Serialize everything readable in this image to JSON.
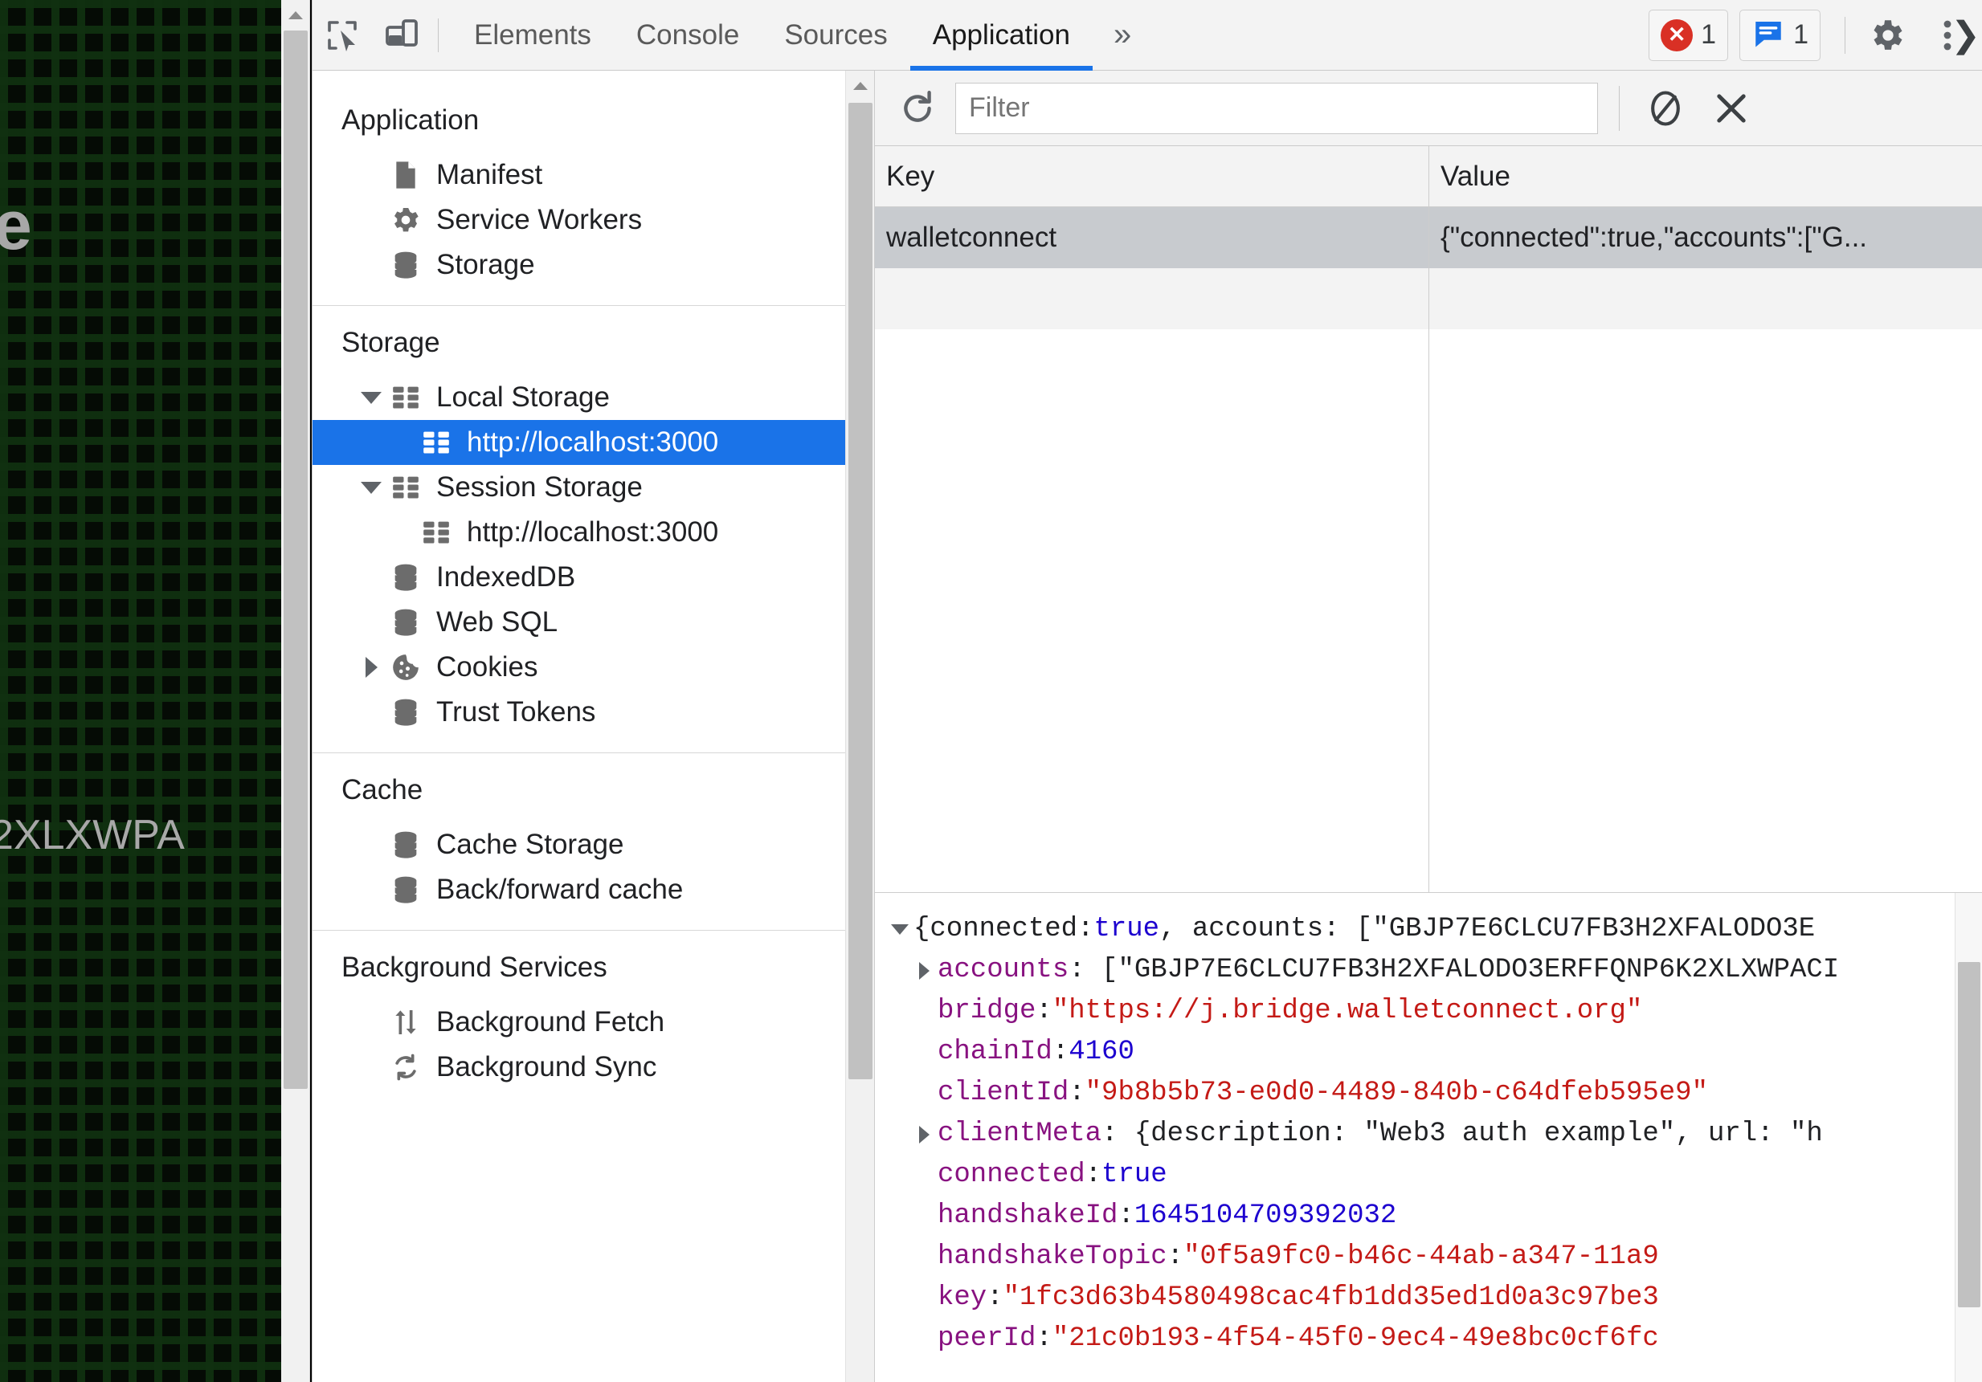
{
  "page_behind": {
    "partial_letter": "e",
    "partial_address": "2XLXWPA"
  },
  "devtools": {
    "toolbar": {
      "inspect_icon": "inspect-cursor-icon",
      "device_toggle_icon": "device-toolbar-icon",
      "tabs": [
        {
          "label": "Elements",
          "active": false
        },
        {
          "label": "Console",
          "active": false
        },
        {
          "label": "Sources",
          "active": false
        },
        {
          "label": "Application",
          "active": true
        }
      ],
      "more_tabs_label": "»",
      "error_badge": {
        "icon": "error-circle-icon",
        "count": "1"
      },
      "message_badge": {
        "icon": "message-bubble-icon",
        "count": "1"
      },
      "settings_icon": "gear-icon",
      "menu_icon": "kebab-menu-icon",
      "close_icon": "chevron-right-icon"
    },
    "sidebar": {
      "sections": [
        {
          "title": "Application",
          "items": [
            {
              "label": "Manifest",
              "icon": "manifest-file-icon",
              "indent": 1,
              "twisty": "none",
              "selected": false
            },
            {
              "label": "Service Workers",
              "icon": "gear-icon",
              "indent": 1,
              "twisty": "none",
              "selected": false
            },
            {
              "label": "Storage",
              "icon": "database-icon",
              "indent": 1,
              "twisty": "none",
              "selected": false
            }
          ]
        },
        {
          "title": "Storage",
          "items": [
            {
              "label": "Local Storage",
              "icon": "table-grid-icon",
              "indent": 1,
              "twisty": "open",
              "selected": false
            },
            {
              "label": "http://localhost:3000",
              "icon": "table-grid-icon",
              "indent": 2,
              "twisty": "none",
              "selected": true
            },
            {
              "label": "Session Storage",
              "icon": "table-grid-icon",
              "indent": 1,
              "twisty": "open",
              "selected": false
            },
            {
              "label": "http://localhost:3000",
              "icon": "table-grid-icon",
              "indent": 2,
              "twisty": "none",
              "selected": false
            },
            {
              "label": "IndexedDB",
              "icon": "database-icon",
              "indent": 1,
              "twisty": "none",
              "selected": false
            },
            {
              "label": "Web SQL",
              "icon": "database-icon",
              "indent": 1,
              "twisty": "none",
              "selected": false
            },
            {
              "label": "Cookies",
              "icon": "cookie-icon",
              "indent": 1,
              "twisty": "closed",
              "selected": false
            },
            {
              "label": "Trust Tokens",
              "icon": "database-icon",
              "indent": 1,
              "twisty": "none",
              "selected": false
            }
          ]
        },
        {
          "title": "Cache",
          "items": [
            {
              "label": "Cache Storage",
              "icon": "database-icon",
              "indent": 1,
              "twisty": "none",
              "selected": false
            },
            {
              "label": "Back/forward cache",
              "icon": "database-icon",
              "indent": 1,
              "twisty": "none",
              "selected": false
            }
          ]
        },
        {
          "title": "Background Services",
          "items": [
            {
              "label": "Background Fetch",
              "icon": "background-fetch-icon",
              "indent": 1,
              "twisty": "none",
              "selected": false
            },
            {
              "label": "Background Sync",
              "icon": "background-sync-icon",
              "indent": 1,
              "twisty": "none",
              "selected": false
            }
          ]
        }
      ]
    },
    "filter_bar": {
      "refresh_icon": "refresh-icon",
      "filter_placeholder": "Filter",
      "filter_value": "",
      "clear_all_icon": "clear-all-circle-slash-icon",
      "delete_icon": "delete-x-icon"
    },
    "storage_table": {
      "columns": [
        "Key",
        "Value"
      ],
      "rows": [
        {
          "key": "walletconnect",
          "value": "{\"connected\":true,\"accounts\":[\"G...",
          "selected": true
        }
      ]
    },
    "preview": {
      "lines": [
        {
          "twisty": "open",
          "indent": 0,
          "parts": [
            {
              "text": "{connected: ",
              "cls": "k-plain"
            },
            {
              "text": "true",
              "cls": "k-bool"
            },
            {
              "text": ", accounts: [",
              "cls": "k-plain"
            },
            {
              "text": "\"GBJP7E6CLCU7FB3H2XFALODO3E",
              "cls": "k-plain"
            }
          ]
        },
        {
          "twisty": "closed",
          "indent": 1,
          "parts": [
            {
              "text": "accounts",
              "cls": "k-prop"
            },
            {
              "text": ": [",
              "cls": "k-plain"
            },
            {
              "text": "\"GBJP7E6CLCU7FB3H2XFALODO3ERFFQNP6K2XLXWPACI",
              "cls": "k-plain"
            }
          ]
        },
        {
          "twisty": "none",
          "indent": 1,
          "parts": [
            {
              "text": "bridge",
              "cls": "k-prop"
            },
            {
              "text": ": ",
              "cls": "k-plain"
            },
            {
              "text": "\"https://j.bridge.walletconnect.org\"",
              "cls": "k-str"
            }
          ]
        },
        {
          "twisty": "none",
          "indent": 1,
          "parts": [
            {
              "text": "chainId",
              "cls": "k-prop"
            },
            {
              "text": ": ",
              "cls": "k-plain"
            },
            {
              "text": "4160",
              "cls": "k-num"
            }
          ]
        },
        {
          "twisty": "none",
          "indent": 1,
          "parts": [
            {
              "text": "clientId",
              "cls": "k-prop"
            },
            {
              "text": ": ",
              "cls": "k-plain"
            },
            {
              "text": "\"9b8b5b73-e0d0-4489-840b-c64dfeb595e9\"",
              "cls": "k-str"
            }
          ]
        },
        {
          "twisty": "closed",
          "indent": 1,
          "parts": [
            {
              "text": "clientMeta",
              "cls": "k-prop"
            },
            {
              "text": ": {description: \"Web3 auth example\", url: \"h",
              "cls": "k-plain"
            }
          ]
        },
        {
          "twisty": "none",
          "indent": 1,
          "parts": [
            {
              "text": "connected",
              "cls": "k-prop"
            },
            {
              "text": ": ",
              "cls": "k-plain"
            },
            {
              "text": "true",
              "cls": "k-bool"
            }
          ]
        },
        {
          "twisty": "none",
          "indent": 1,
          "parts": [
            {
              "text": "handshakeId",
              "cls": "k-prop"
            },
            {
              "text": ": ",
              "cls": "k-plain"
            },
            {
              "text": "1645104709392032",
              "cls": "k-num"
            }
          ]
        },
        {
          "twisty": "none",
          "indent": 1,
          "parts": [
            {
              "text": "handshakeTopic",
              "cls": "k-prop"
            },
            {
              "text": ": ",
              "cls": "k-plain"
            },
            {
              "text": "\"0f5a9fc0-b46c-44ab-a347-11a9",
              "cls": "k-str"
            }
          ]
        },
        {
          "twisty": "none",
          "indent": 1,
          "parts": [
            {
              "text": "key",
              "cls": "k-prop"
            },
            {
              "text": ": ",
              "cls": "k-plain"
            },
            {
              "text": "\"1fc3d63b4580498cac4fb1dd35ed1d0a3c97be3",
              "cls": "k-str"
            }
          ]
        },
        {
          "twisty": "none",
          "indent": 1,
          "parts": [
            {
              "text": "peerId",
              "cls": "k-prop"
            },
            {
              "text": ": ",
              "cls": "k-plain"
            },
            {
              "text": "\"21c0b193-4f54-45f0-9ec4-49e8bc0cf6fc",
              "cls": "k-str"
            }
          ]
        }
      ]
    }
  },
  "colors": {
    "accent_blue": "#1a73e8",
    "error_red": "#d93025",
    "json_property": "#881280",
    "json_string": "#c41a16",
    "json_number": "#1c00cf",
    "selected_row": "#c8cbcf"
  }
}
